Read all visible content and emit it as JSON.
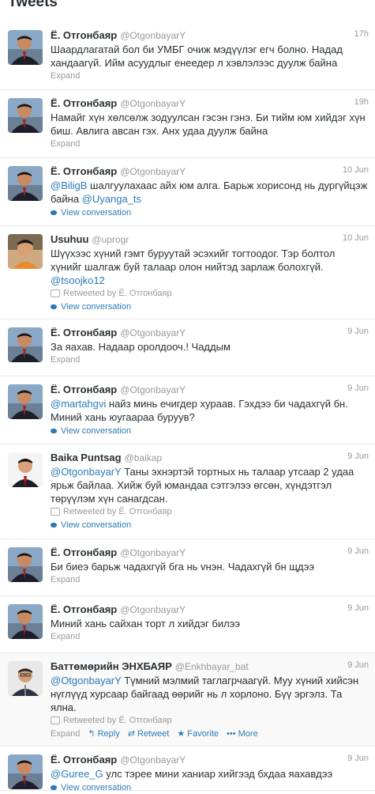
{
  "header": {
    "title": "Tweets"
  },
  "colors": {
    "link": "#2b7bb9",
    "muted": "#999999",
    "text": "#292f33"
  },
  "tweets": [
    {
      "name": "Ё. Отгонбаяр",
      "handle": "@OtgonbayarY",
      "time": "17h",
      "segments": [
        {
          "t": "Шаардлагатай бол би УМБГ очиж мэдүүлэг егч болно. Надад хандаагүй. Ийм асуудлыг енеедер л хэвлэлээс дуулж байна",
          "m": false
        }
      ],
      "retweet": "",
      "footer": "Expand"
    },
    {
      "name": "Ё. Отгонбаяр",
      "handle": "@OtgonbayarY",
      "time": "19h",
      "segments": [
        {
          "t": "Намайг хүн хөлсөлж зодуулсан гэсэн гэнэ. Би тийм юм хийдэг хүн биш. Авлига авсан гэх. Анх удаа дуулж байна",
          "m": false
        }
      ],
      "retweet": "",
      "footer": "Expand"
    },
    {
      "name": "Ё. Отгонбаяр",
      "handle": "@OtgonbayarY",
      "time": "10 Jun",
      "segments": [
        {
          "t": "@BiligB",
          "m": true
        },
        {
          "t": " шалгуулахаас айх юм алга. Барьж хорисонд нь дургүйцэж байна ",
          "m": false
        },
        {
          "t": "@Uyanga_ts",
          "m": true
        }
      ],
      "retweet": "",
      "footer": "View conversation"
    },
    {
      "name": "Usuhuu",
      "handle": "@uprogr",
      "time": "10 Jun",
      "segments": [
        {
          "t": "Шүүхээс хүний гэмт буруутай эсэхийг тогтоодог. Тэр болтол хүнийг шалгаж буй талаар олон нийтэд зарлаж болохгүй. ",
          "m": false
        },
        {
          "t": "@tsoojko12",
          "m": true
        }
      ],
      "retweet": "Retweeted by Ё. Отгонбаяр",
      "footer": "View conversation"
    },
    {
      "name": "Ё. Отгонбаяр",
      "handle": "@OtgonbayarY",
      "time": "9 Jun",
      "segments": [
        {
          "t": "За яахав. Надаар оролдооч.! Чаддым",
          "m": false
        }
      ],
      "retweet": "",
      "footer": "Expand"
    },
    {
      "name": "Ё. Отгонбаяр",
      "handle": "@OtgonbayarY",
      "time": "9 Jun",
      "segments": [
        {
          "t": "@martahgvi",
          "m": true
        },
        {
          "t": " найз минь ечигдер хураав. Гэхдээ би чадахгүй бн. Миний хань юугаараа буруув?",
          "m": false
        }
      ],
      "retweet": "",
      "footer": "View conversation"
    },
    {
      "name": "Baika Puntsag",
      "handle": "@baikap",
      "time": "9 Jun",
      "segments": [
        {
          "t": "@OtgonbayarY",
          "m": true
        },
        {
          "t": " Таны эхнэртэй тортных нь талаар утсаар 2 удаа ярьж байлаа. Хийж буй юмандаа сэтгэлээ өгсөн, хүндэтгэл төрүүлэм хүн санагдсан.",
          "m": false
        }
      ],
      "retweet": "Retweeted by Ё. Отгонбаяр",
      "footer": "View conversation"
    },
    {
      "name": "Ё. Отгонбаяр",
      "handle": "@OtgonbayarY",
      "time": "9 Jun",
      "segments": [
        {
          "t": "Би биеэ барьж чадахгүй бга нь vнэн. Чадахгүй бн щдээ",
          "m": false
        }
      ],
      "retweet": "",
      "footer": "Expand"
    },
    {
      "name": "Ё. Отгонбаяр",
      "handle": "@OtgonbayarY",
      "time": "9 Jun",
      "segments": [
        {
          "t": "Миний хань сайхан торт л хийдэг билээ",
          "m": false
        }
      ],
      "retweet": "",
      "footer": "Expand"
    },
    {
      "name": "Баттөмөрийн ЭНХБАЯР",
      "handle": "@Enkhbayar_bat",
      "time": "9 Jun",
      "segments": [
        {
          "t": "@OtgonbayarY",
          "m": true
        },
        {
          "t": " Түмний мэлмий таглагрчаагүй. Муу хүний хийсэн нүглүүд хурсаар байгаад өөрийг нь л хорлоно. Бүү эргэлз. Та ялна.",
          "m": false
        }
      ],
      "retweet": "Retweeted by Ё. Отгонбаяр",
      "footer": "",
      "actions": {
        "expand": "Expand",
        "reply": "Reply",
        "retweet": "Retweet",
        "favorite": "Favorite",
        "more": "More"
      }
    },
    {
      "name": "Ё. Отгонбаяр",
      "handle": "@OtgonbayarY",
      "time": "9 Jun",
      "segments": [
        {
          "t": "@Guree_G",
          "m": true
        },
        {
          "t": " улс тэрее мини ханиар хийгээд бхдаа яахавдээ",
          "m": false
        }
      ],
      "retweet": "",
      "footer": "View conversation"
    }
  ]
}
